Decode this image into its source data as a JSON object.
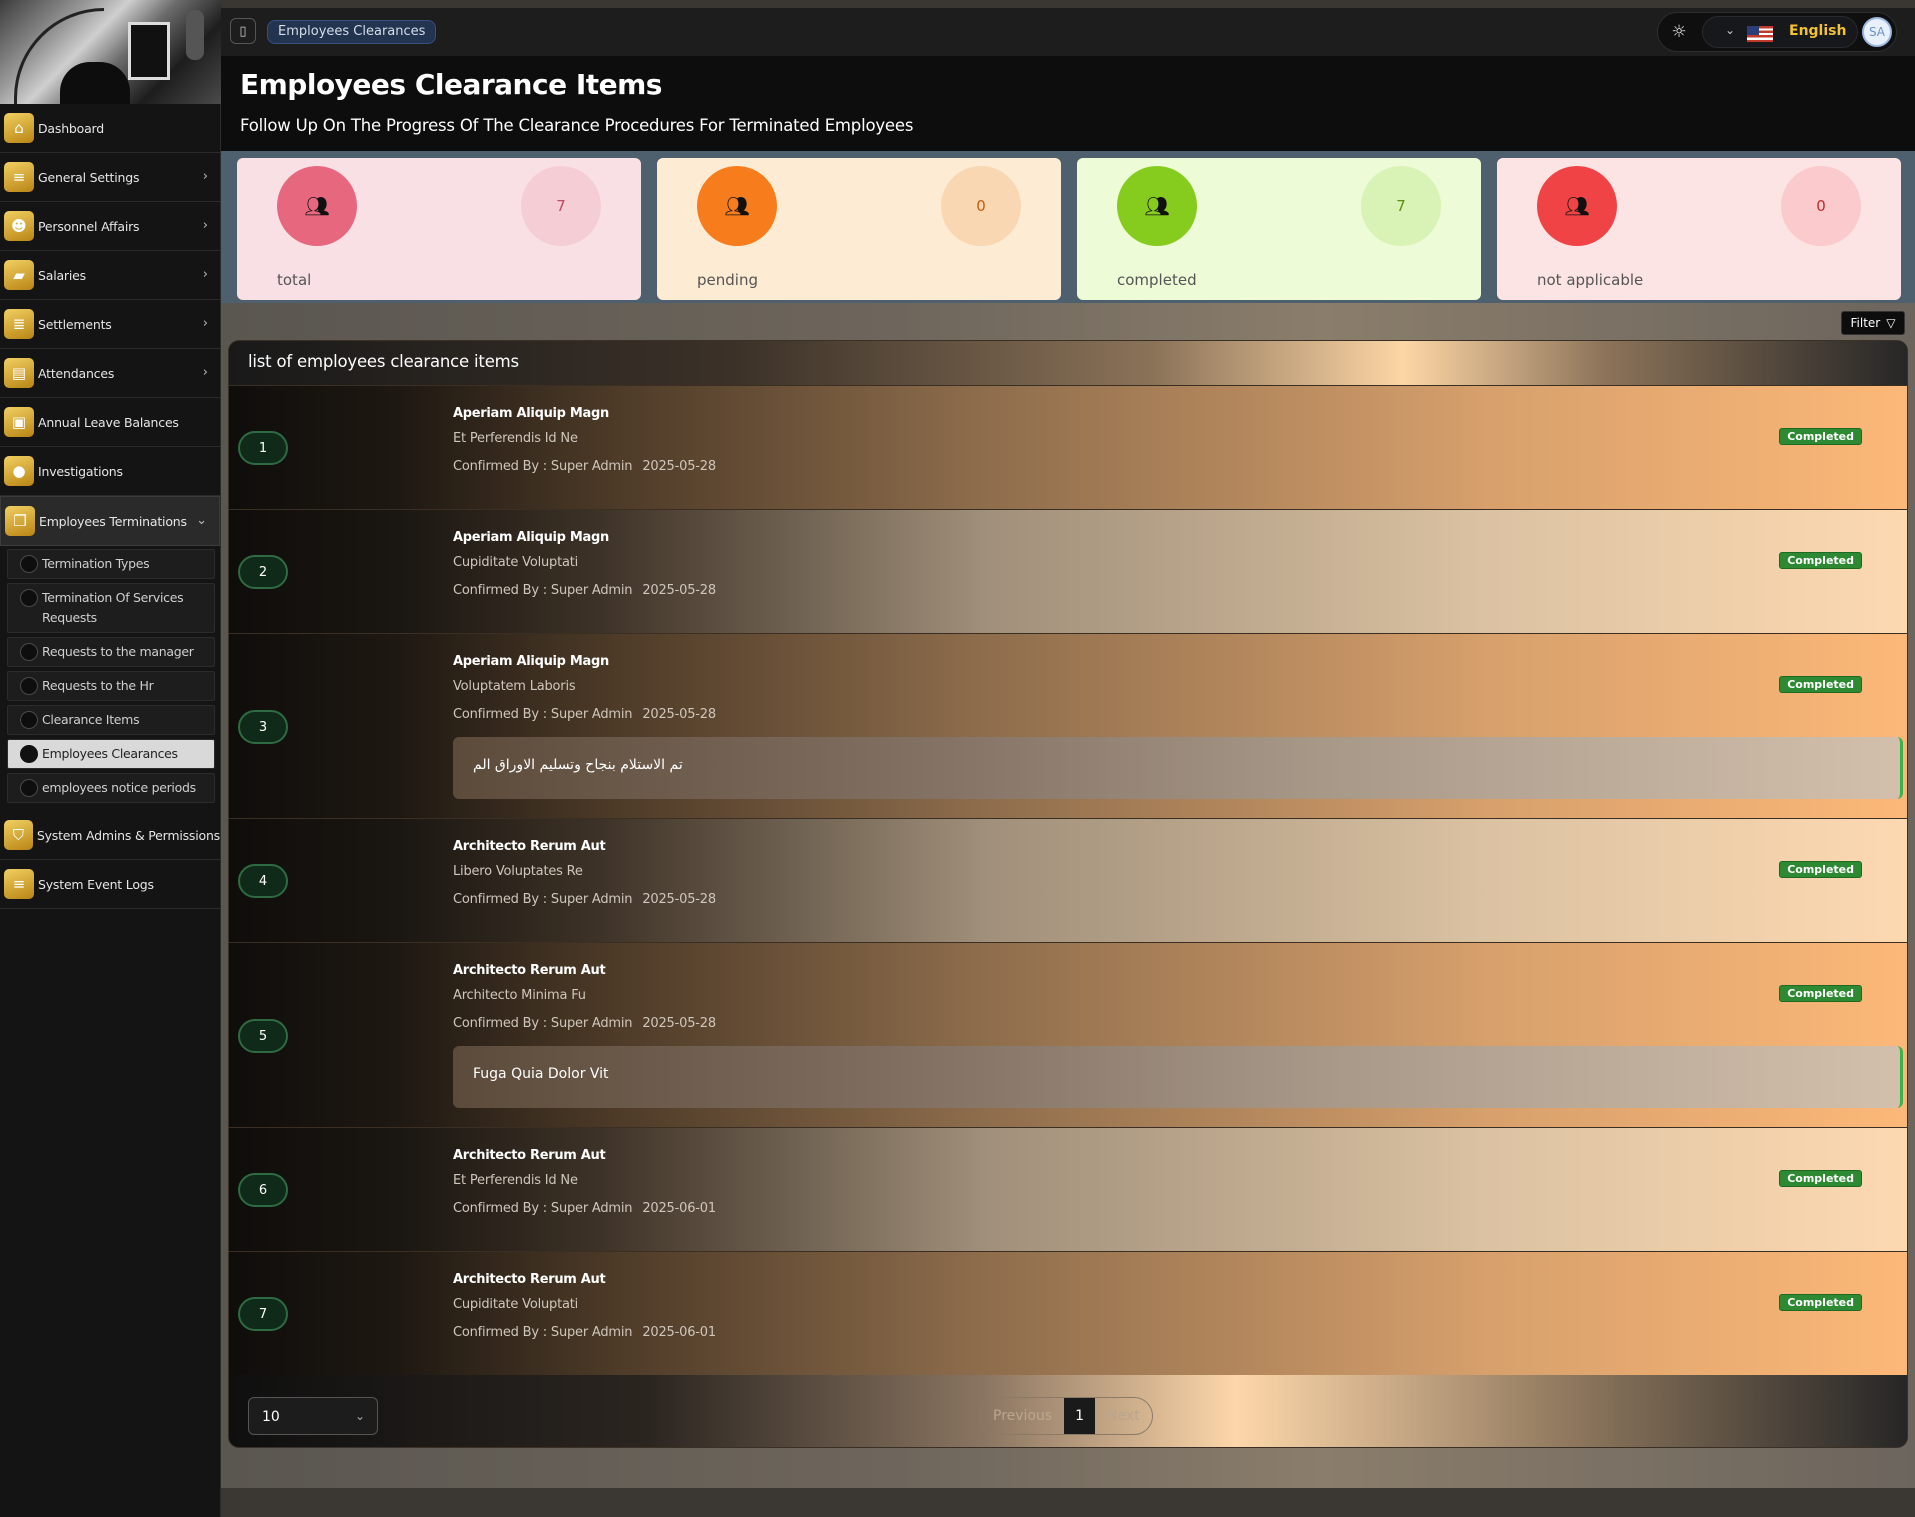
{
  "sidebar": {
    "items": [
      {
        "label": "Dashboard",
        "icon": "home-icon",
        "glyph": "⌂"
      },
      {
        "label": "General Settings",
        "icon": "settings-sliders-icon",
        "glyph": "≡"
      },
      {
        "label": "Personnel Affairs",
        "icon": "users-icon",
        "glyph": "☻"
      },
      {
        "label": "Salaries",
        "icon": "salaries-icon",
        "glyph": "▰"
      },
      {
        "label": "Settlements",
        "icon": "list-icon",
        "glyph": "≣"
      },
      {
        "label": "Attendances",
        "icon": "attendance-icon",
        "glyph": "▤"
      },
      {
        "label": "Annual Leave Balances",
        "icon": "bag-icon",
        "glyph": "▣"
      },
      {
        "label": "Investigations",
        "icon": "circle-icon",
        "glyph": "●"
      },
      {
        "label": "Employees Terminations",
        "icon": "documents-icon",
        "glyph": "❐"
      }
    ],
    "sub_items": [
      "Termination Types",
      "Termination Of Services Requests",
      "Requests to the manager",
      "Requests to the Hr",
      "Clearance Items",
      "Employees Clearances",
      "employees notice periods"
    ],
    "bottom_items": [
      {
        "label": "System Admins & Permissions",
        "icon": "shield-icon",
        "glyph": "⛉"
      },
      {
        "label": "System Event Logs",
        "icon": "log-list-icon",
        "glyph": "≡"
      }
    ]
  },
  "topbar": {
    "breadcrumb": "Employees Clearances",
    "language": "English",
    "avatar_initials": "SA"
  },
  "header": {
    "title": "Employees Clearance Items",
    "subtitle": "Follow Up On The Progress Of The Clearance Procedures For Terminated Employees"
  },
  "stats": [
    {
      "label": "total",
      "count": "7",
      "color": "#e7677f",
      "bg": "#f9e0e4",
      "count_bg": "#f5cdd4",
      "count_color": "#c24a60"
    },
    {
      "label": "pending",
      "count": "0",
      "color": "#f77c1c",
      "bg": "#fdebd3",
      "count_bg": "#fad7b3",
      "count_color": "#c85d0d"
    },
    {
      "label": "completed",
      "count": "7",
      "color": "#86cc1e",
      "bg": "#edfbd6",
      "count_bg": "#d9f2b6",
      "count_color": "#5b8f12"
    },
    {
      "label": "not applicable",
      "count": "0",
      "color": "#ef4346",
      "bg": "#fde4e4",
      "count_bg": "#fbcacc",
      "count_color": "#c02b2e"
    }
  ],
  "filter_label": "Filter",
  "list": {
    "title": "list of employees clearance items",
    "confirmed_prefix": "Confirmed By :",
    "rows": [
      {
        "num": "1",
        "title": "Aperiam Aliquip Magn",
        "item": "Et Perferendis Id Ne",
        "by": "Super Admin",
        "date": "2025-05-28",
        "status": "Completed",
        "note": ""
      },
      {
        "num": "2",
        "title": "Aperiam Aliquip Magn",
        "item": "Cupiditate Voluptati",
        "by": "Super Admin",
        "date": "2025-05-28",
        "status": "Completed",
        "note": ""
      },
      {
        "num": "3",
        "title": "Aperiam Aliquip Magn",
        "item": "Voluptatem Laboris",
        "by": "Super Admin",
        "date": "2025-05-28",
        "status": "Completed",
        "note": "تم الاستلام بنجاح وتسليم الاوراق الم"
      },
      {
        "num": "4",
        "title": "Architecto Rerum Aut",
        "item": "Libero Voluptates Re",
        "by": "Super Admin",
        "date": "2025-05-28",
        "status": "Completed",
        "note": ""
      },
      {
        "num": "5",
        "title": "Architecto Rerum Aut",
        "item": "Architecto Minima Fu",
        "by": "Super Admin",
        "date": "2025-05-28",
        "status": "Completed",
        "note": "Fuga Quia Dolor Vit"
      },
      {
        "num": "6",
        "title": "Architecto Rerum Aut",
        "item": "Et Perferendis Id Ne",
        "by": "Super Admin",
        "date": "2025-06-01",
        "status": "Completed",
        "note": ""
      },
      {
        "num": "7",
        "title": "Architecto Rerum Aut",
        "item": "Cupiditate Voluptati",
        "by": "Super Admin",
        "date": "2025-06-01",
        "status": "Completed",
        "note": ""
      }
    ]
  },
  "pagination": {
    "page_size": "10",
    "previous": "Previous",
    "current": "1",
    "next": "Next"
  }
}
